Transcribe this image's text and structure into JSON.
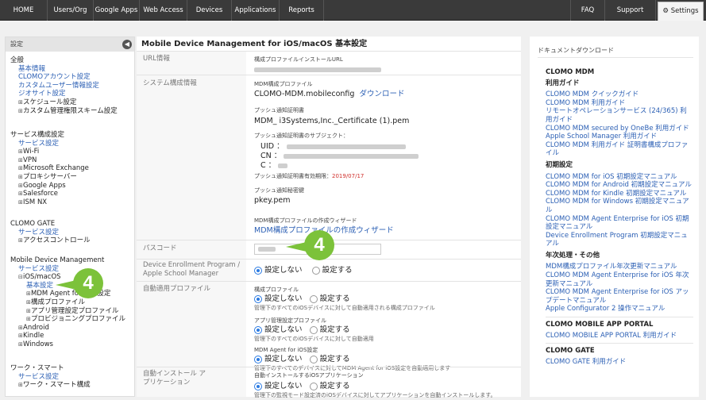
{
  "topnav": {
    "tabs": [
      {
        "label": "HOME"
      },
      {
        "label": "Users/Org"
      },
      {
        "label": "Google Apps"
      },
      {
        "label": "Web Access"
      },
      {
        "label": "Devices"
      },
      {
        "label": "Applications"
      },
      {
        "label": "Reports"
      },
      {
        "label": "FAQ"
      },
      {
        "label": "Support"
      },
      {
        "label": "Settings"
      }
    ]
  },
  "sidebar": {
    "header": "設定",
    "general": {
      "title": "全般",
      "items": [
        "基本情報",
        "CLOMOアカウント設定",
        "カスタムユーザー情報設定",
        "ジオサイト設定",
        "スケジュール設定",
        "カスタム管理権限スキーム設定"
      ]
    },
    "service": {
      "title": "サービス構成設定",
      "items": [
        "サービス設定",
        "Wi-Fi",
        "VPN",
        "Microsoft Exchange",
        "プロキシサーバー",
        "Google Apps",
        "Salesforce",
        "ISM NX"
      ]
    },
    "gate": {
      "title": "CLOMO GATE",
      "items": [
        "サービス設定",
        "アクセスコントロール"
      ]
    },
    "mdm": {
      "title": "Mobile Device Management",
      "items": [
        "サービス設定",
        "iOS/macOS",
        "基本設定",
        "MDM Agent for iOS 設定",
        "構成プロファイル",
        "アプリ管理設定プロファイル",
        "プロビジョニングプロファイル",
        "Android",
        "Kindle",
        "Windows"
      ]
    },
    "work": {
      "title": "ワーク・スマート",
      "items": [
        "サービス設定",
        "ワーク・スマート構成"
      ]
    }
  },
  "main": {
    "title": "Mobile Device Management for iOS/macOS 基本設定",
    "url_label": "URL情報",
    "url_caption": "構成プロファイルインストールURL",
    "sys_label": "システム構成情報",
    "mdm_profile_caption": "MDM構成プロファイル",
    "mdm_profile_file": "CLOMO-MDM.mobileconfig",
    "download": "ダウンロード",
    "push_cert_caption": "プッシュ通知証明書",
    "push_cert_file": "MDM_ i3Systems,Inc._Certificate (1).pem",
    "push_subject_caption": "プッシュ通知証明書のサブジェクト：",
    "uid": "UID ：",
    "cn": "CN ：",
    "c": "C ：",
    "expiry_label": "プッシュ通知証明書有効期限：",
    "expiry_value": "2019/07/17",
    "push_key_caption": "プッシュ通知秘密鍵",
    "push_key_file": "pkey.pem",
    "wizard_caption": "MDM構成プロファイルの作成ウィザード",
    "wizard_link": "MDM構成プロファイルの作成ウィザード",
    "passcode_label": "パスコード",
    "dep_label": "Device Enrollment Program / Apple School Manager",
    "auto_label": "自動適用プロファイル",
    "profile_caption": "構成プロファイル",
    "profile_note": "管理下のすべてのiOSデバイスに対して自動適用される構成プロファイル",
    "app_caption": "アプリ管理設定プロファイル",
    "app_note": "管理下のすべてのiOSデバイスに対して自動適用",
    "agent_caption": "MDM Agent for iOS設定",
    "agent_note": "管理下のすべてのデバイスに対してMDM Agent for iOS設定を自動適用します",
    "autoinstall_label": "自動インストール アプリケーション",
    "autoinstall_caption": "自動インストールするiOSアプリケーション",
    "autoinstall_note": "管理下の監視モード設定済のiOSデバイスに対してアプリケーションを自動インストールします。",
    "no": "設定しない",
    "yes": "設定する"
  },
  "badge": "4",
  "right": {
    "title": "ドキュメントダウンロード",
    "sections": [
      {
        "heading": "CLOMO MDM",
        "sub": "利用ガイド",
        "links": [
          "CLOMO MDM クイックガイド",
          "CLOMO MDM 利用ガイド",
          "リモートオペレーションサービス (24/365) 利用ガイド",
          "CLOMO MDM secured by OneBe 利用ガイド",
          "Apple School Manager 利用ガイド",
          "CLOMO MDM 利用ガイド 証明書構成プロファイル"
        ]
      },
      {
        "heading": "",
        "sub": "初期設定",
        "links": [
          "CLOMO MDM for iOS 初期設定マニュアル",
          "CLOMO MDM for Android 初期設定マニュアル",
          "CLOMO MDM for Kindle 初期設定マニュアル",
          "CLOMO MDM for Windows 初期設定マニュアル",
          "CLOMO MDM Agent Enterprise for iOS 初期設定マニュアル",
          "Device Enrollment Program 初期設定マニュアル"
        ]
      },
      {
        "heading": "",
        "sub": "年次処理・その他",
        "links": [
          "MDM構成プロファイル年次更新マニュアル",
          "CLOMO MDM Agent Enterprise for iOS 年次更新マニュアル",
          "CLOMO MDM Agent Enterprise for iOS アップデートマニュアル",
          "Apple Configurator 2 操作マニュアル"
        ]
      },
      {
        "heading": "CLOMO MOBILE APP PORTAL",
        "sub": "",
        "links": [
          "CLOMO MOBILE APP PORTAL 利用ガイド"
        ]
      },
      {
        "heading": "CLOMO GATE",
        "sub": "",
        "links": [
          "CLOMO GATE 利用ガイド"
        ]
      }
    ]
  }
}
